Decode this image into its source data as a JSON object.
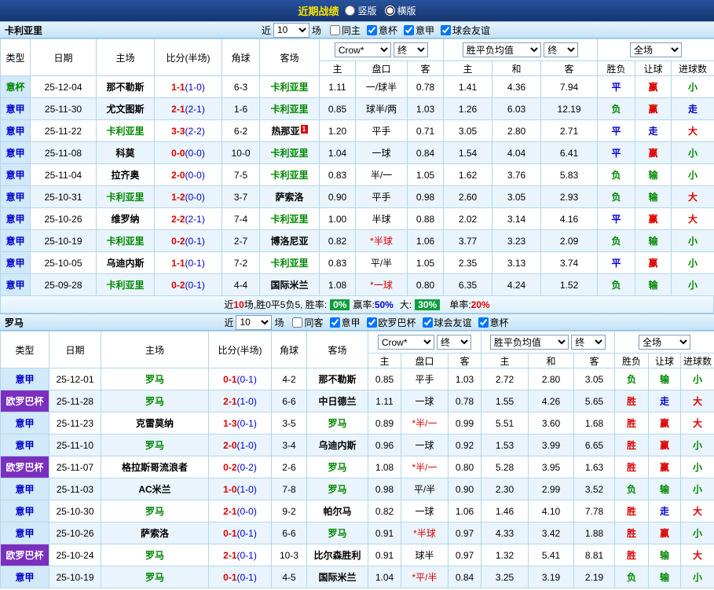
{
  "topbar": {
    "title": "近期战绩",
    "options": [
      {
        "label": "竖版",
        "selected": false
      },
      {
        "label": "横版",
        "selected": true
      }
    ]
  },
  "labels": {
    "near": "近",
    "games": "场"
  },
  "selects": {
    "company": "Crow*",
    "stage": "终",
    "avg": "胜平负均值",
    "scope": "全场"
  },
  "cols": {
    "type": "类型",
    "date": "日期",
    "home": "主场",
    "score": "比分(半场)",
    "corner": "角球",
    "away": "客场",
    "sub": [
      "主",
      "盘口",
      "客",
      "主",
      "和",
      "客",
      "胜负",
      "让球",
      "进球数"
    ]
  },
  "colors": {
    "accent_blue": "#0000cc",
    "accent_red": "#dd0000",
    "accent_green": "#008800",
    "europa_purple": "#7b2fbe",
    "badge_green": "#0b9f3d"
  },
  "t1": {
    "team": "卡利亚里",
    "count": "10",
    "boxes": [
      {
        "label": "同主",
        "checked": false
      },
      {
        "label": "意杯",
        "checked": true
      },
      {
        "label": "意甲",
        "checked": true
      },
      {
        "label": "球会友谊",
        "checked": true
      }
    ],
    "rows": [
      {
        "type": "意杯",
        "date": "25-12-04",
        "home": "那不勒斯",
        "score": "1-1",
        "half": "(1-0)",
        "corner": "6-3",
        "away": "卡利亚里",
        "o1": "1.11",
        "hcap": "一/球半",
        "o2": "0.78",
        "a1": "1.41",
        "a2": "4.36",
        "a3": "7.94",
        "r1": "平",
        "r2": "赢",
        "r3": "小"
      },
      {
        "type": "意甲",
        "date": "25-11-30",
        "home": "尤文图斯",
        "score": "2-1",
        "half": "(2-1)",
        "corner": "1-6",
        "away": "卡利亚里",
        "o1": "0.85",
        "hcap": "球半/两",
        "o2": "1.03",
        "a1": "1.26",
        "a2": "6.03",
        "a3": "12.19",
        "r1": "负",
        "r2": "赢",
        "r3": "走"
      },
      {
        "type": "意甲",
        "date": "25-11-22",
        "home": "卡利亚里",
        "score": "3-3",
        "half": "(2-2)",
        "corner": "6-2",
        "away": "热那亚",
        "away_badge": "1",
        "o1": "1.20",
        "hcap": "平手",
        "o2": "0.71",
        "a1": "3.05",
        "a2": "2.80",
        "a3": "2.71",
        "r1": "平",
        "r2": "走",
        "r3": "大"
      },
      {
        "type": "意甲",
        "date": "25-11-08",
        "home": "科莫",
        "score": "0-0",
        "half": "(0-0)",
        "corner": "10-0",
        "away": "卡利亚里",
        "o1": "1.04",
        "hcap": "一球",
        "o2": "0.84",
        "a1": "1.54",
        "a2": "4.04",
        "a3": "6.41",
        "r1": "平",
        "r2": "赢",
        "r3": "小"
      },
      {
        "type": "意甲",
        "date": "25-11-04",
        "home": "拉齐奥",
        "score": "2-0",
        "half": "(0-0)",
        "corner": "7-5",
        "away": "卡利亚里",
        "o1": "0.83",
        "hcap": "半/一",
        "o2": "1.05",
        "a1": "1.62",
        "a2": "3.76",
        "a3": "5.83",
        "r1": "负",
        "r2": "输",
        "r3": "小"
      },
      {
        "type": "意甲",
        "date": "25-10-31",
        "home": "卡利亚里",
        "score": "1-2",
        "half": "(0-0)",
        "corner": "3-7",
        "away": "萨索洛",
        "o1": "0.90",
        "hcap": "平手",
        "o2": "0.98",
        "a1": "2.60",
        "a2": "3.05",
        "a3": "2.93",
        "r1": "负",
        "r2": "输",
        "r3": "大"
      },
      {
        "type": "意甲",
        "date": "25-10-26",
        "home": "维罗纳",
        "score": "2-2",
        "half": "(2-1)",
        "corner": "7-4",
        "away": "卡利亚里",
        "o1": "1.00",
        "hcap": "半球",
        "o2": "0.88",
        "a1": "2.02",
        "a2": "3.14",
        "a3": "4.16",
        "r1": "平",
        "r2": "赢",
        "r3": "大"
      },
      {
        "type": "意甲",
        "date": "25-10-19",
        "home": "卡利亚里",
        "score": "0-2",
        "half": "(0-1)",
        "corner": "2-7",
        "away": "博洛尼亚",
        "o1": "0.82",
        "hcap": "*半球",
        "o2": "1.06",
        "a1": "3.77",
        "a2": "3.23",
        "a3": "2.09",
        "r1": "负",
        "r2": "输",
        "r3": "小"
      },
      {
        "type": "意甲",
        "date": "25-10-05",
        "home": "乌迪内斯",
        "score": "1-1",
        "half": "(0-1)",
        "corner": "7-2",
        "away": "卡利亚里",
        "o1": "0.83",
        "hcap": "平/半",
        "o2": "1.05",
        "a1": "2.35",
        "a2": "3.13",
        "a3": "3.74",
        "r1": "平",
        "r2": "赢",
        "r3": "小"
      },
      {
        "type": "意甲",
        "date": "25-09-28",
        "home": "卡利亚里",
        "score": "0-2",
        "half": "(0-1)",
        "corner": "4-4",
        "away": "国际米兰",
        "o1": "1.08",
        "hcap": "*一球",
        "o2": "0.80",
        "a1": "6.35",
        "a2": "4.24",
        "a3": "1.52",
        "r1": "负",
        "r2": "输",
        "r3": "小"
      }
    ],
    "summary": {
      "p1": "近",
      "n1": "10",
      "p2": "场,胜0平5负5, 胜率:",
      "badge1": "0%",
      "p3": "赢率:",
      "v3": "50%",
      "p4": "大:",
      "badge2": "30%",
      "p5": "单率:",
      "v5": "20%"
    }
  },
  "t2": {
    "team": "罗马",
    "count": "10",
    "boxes": [
      {
        "label": "同客",
        "checked": false
      },
      {
        "label": "意甲",
        "checked": true
      },
      {
        "label": "欧罗巴杯",
        "checked": true
      },
      {
        "label": "球会友谊",
        "checked": true
      },
      {
        "label": "意杯",
        "checked": true
      }
    ],
    "rows": [
      {
        "type": "意甲",
        "date": "25-12-01",
        "home": "罗马",
        "score": "0-1",
        "half": "(0-1)",
        "corner": "4-2",
        "away": "那不勒斯",
        "o1": "0.85",
        "hcap": "平手",
        "o2": "1.03",
        "a1": "2.72",
        "a2": "2.80",
        "a3": "3.05",
        "r1": "负",
        "r2": "输",
        "r3": "小"
      },
      {
        "type": "欧罗巴杯",
        "date": "25-11-28",
        "home": "罗马",
        "score": "2-1",
        "half": "(1-0)",
        "corner": "6-6",
        "away": "中日德兰",
        "o1": "1.11",
        "hcap": "一球",
        "o2": "0.78",
        "a1": "1.55",
        "a2": "4.26",
        "a3": "5.65",
        "r1": "胜",
        "r2": "走",
        "r3": "大"
      },
      {
        "type": "意甲",
        "date": "25-11-23",
        "home": "克雷莫纳",
        "score": "1-3",
        "half": "(0-1)",
        "corner": "3-5",
        "away": "罗马",
        "o1": "0.89",
        "hcap": "*半/一",
        "o2": "0.99",
        "a1": "5.51",
        "a2": "3.60",
        "a3": "1.68",
        "r1": "胜",
        "r2": "赢",
        "r3": "大"
      },
      {
        "type": "意甲",
        "date": "25-11-10",
        "home": "罗马",
        "score": "2-0",
        "half": "(1-0)",
        "corner": "3-4",
        "away": "乌迪内斯",
        "o1": "0.96",
        "hcap": "一球",
        "o2": "0.92",
        "a1": "1.53",
        "a2": "3.99",
        "a3": "6.65",
        "r1": "胜",
        "r2": "赢",
        "r3": "小"
      },
      {
        "type": "欧罗巴杯",
        "date": "25-11-07",
        "home": "格拉斯哥流浪者",
        "score": "0-2",
        "half": "(0-2)",
        "corner": "2-6",
        "away": "罗马",
        "o1": "1.08",
        "hcap": "*半/一",
        "o2": "0.80",
        "a1": "5.28",
        "a2": "3.95",
        "a3": "1.63",
        "r1": "胜",
        "r2": "赢",
        "r3": "小"
      },
      {
        "type": "意甲",
        "date": "25-11-03",
        "home": "AC米兰",
        "score": "1-0",
        "half": "(1-0)",
        "corner": "7-8",
        "away": "罗马",
        "o1": "0.98",
        "hcap": "平/半",
        "o2": "0.90",
        "a1": "2.30",
        "a2": "2.99",
        "a3": "3.52",
        "r1": "负",
        "r2": "输",
        "r3": "小"
      },
      {
        "type": "意甲",
        "date": "25-10-30",
        "home": "罗马",
        "score": "2-1",
        "half": "(0-0)",
        "corner": "9-2",
        "away": "帕尔马",
        "o1": "0.82",
        "hcap": "一球",
        "o2": "1.06",
        "a1": "1.46",
        "a2": "4.10",
        "a3": "7.78",
        "r1": "胜",
        "r2": "走",
        "r3": "大"
      },
      {
        "type": "意甲",
        "date": "25-10-26",
        "home": "萨索洛",
        "score": "0-1",
        "half": "(0-1)",
        "corner": "6-6",
        "away": "罗马",
        "o1": "0.91",
        "hcap": "*半球",
        "o2": "0.97",
        "a1": "4.33",
        "a2": "3.42",
        "a3": "1.88",
        "r1": "胜",
        "r2": "赢",
        "r3": "小"
      },
      {
        "type": "欧罗巴杯",
        "date": "25-10-24",
        "home": "罗马",
        "score": "2-1",
        "half": "(0-1)",
        "corner": "10-3",
        "away": "比尔森胜利",
        "o1": "0.91",
        "hcap": "球半",
        "o2": "0.97",
        "a1": "1.32",
        "a2": "5.41",
        "a3": "8.81",
        "r1": "胜",
        "r2": "输",
        "r3": "大"
      },
      {
        "type": "意甲",
        "date": "25-10-19",
        "home": "罗马",
        "score": "0-1",
        "half": "(0-1)",
        "corner": "4-5",
        "away": "国际米兰",
        "o1": "1.04",
        "hcap": "*平/半",
        "o2": "0.84",
        "a1": "3.25",
        "a2": "3.19",
        "a3": "2.19",
        "r1": "负",
        "r2": "输",
        "r3": "小"
      }
    ]
  }
}
